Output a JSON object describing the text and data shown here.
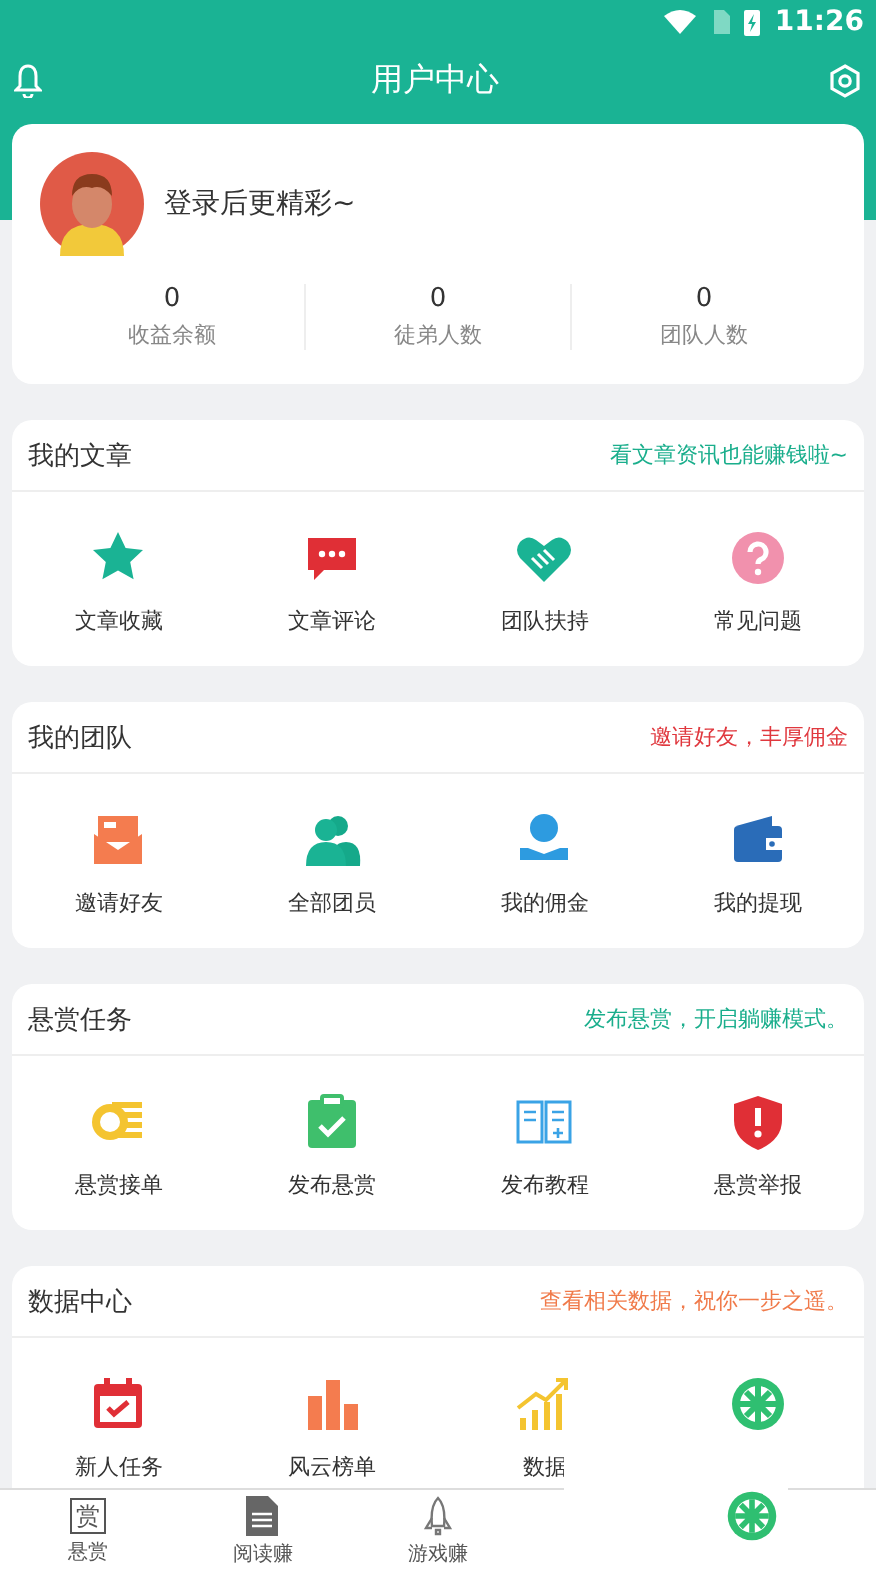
{
  "status_bar": {
    "time": "11:26"
  },
  "header": {
    "title": "用户中心"
  },
  "profile": {
    "login_prompt": "登录后更精彩~",
    "stats": [
      {
        "value": "0",
        "label": "收益余额"
      },
      {
        "value": "0",
        "label": "徒弟人数"
      },
      {
        "value": "0",
        "label": "团队人数"
      }
    ]
  },
  "sections": [
    {
      "title": "我的文章",
      "subtitle": "看文章资讯也能赚钱啦~",
      "color": "#1aae8c",
      "items": [
        {
          "label": "文章收藏"
        },
        {
          "label": "文章评论"
        },
        {
          "label": "团队扶持"
        },
        {
          "label": "常见问题"
        }
      ]
    },
    {
      "title": "我的团队",
      "subtitle": "邀请好友，丰厚佣金",
      "color": "#e0383e",
      "items": [
        {
          "label": "邀请好友"
        },
        {
          "label": "全部团员"
        },
        {
          "label": "我的佣金"
        },
        {
          "label": "我的提现"
        }
      ]
    },
    {
      "title": "悬赏任务",
      "subtitle": "发布悬赏，开启躺赚模式。",
      "color": "#1aae8c",
      "items": [
        {
          "label": "悬赏接单"
        },
        {
          "label": "发布悬赏"
        },
        {
          "label": "发布教程"
        },
        {
          "label": "悬赏举报"
        }
      ]
    },
    {
      "title": "数据中心",
      "subtitle": "查看相关数据，祝你一步之遥。",
      "color": "#f07a4a",
      "items": [
        {
          "label": "新人任务"
        },
        {
          "label": "风云榜单"
        },
        {
          "label": "数据"
        }
      ]
    }
  ],
  "bottom_nav": [
    {
      "label": "悬赏",
      "icon_text": "赏"
    },
    {
      "label": "阅读赚"
    },
    {
      "label": "游戏赚"
    }
  ]
}
